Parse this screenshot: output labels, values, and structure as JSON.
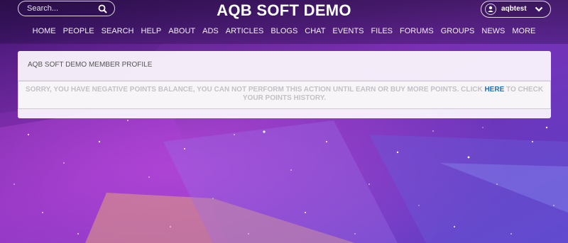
{
  "header": {
    "site_title": "AQB SOFT DEMO",
    "search": {
      "placeholder": "Search...",
      "icon": "search-icon"
    },
    "user": {
      "name": "aqbtest",
      "icon": "user-icon",
      "menu_icon": "chevron-down-icon"
    }
  },
  "nav": {
    "items": [
      "HOME",
      "PEOPLE",
      "SEARCH",
      "HELP",
      "ABOUT",
      "ADS",
      "ARTICLES",
      "BLOGS",
      "CHAT",
      "EVENTS",
      "FILES",
      "FORUMS",
      "GROUPS",
      "NEWS",
      "MORE"
    ]
  },
  "panel": {
    "title": "AQB SOFT DEMO MEMBER PROFILE",
    "message_before": "SORRY, YOU HAVE NEGATIVE POINTS BALANCE, YOU CAN NOT PERFORM THIS ACTION UNTIL EARN OR BUY MORE POINTS. CLICK ",
    "message_link": "HERE",
    "message_after": " TO CHECK YOUR POINTS HISTORY."
  },
  "colors": {
    "link": "#1f6fbe",
    "message_text": "#c3c1c6",
    "background": "#4b1a7a"
  }
}
